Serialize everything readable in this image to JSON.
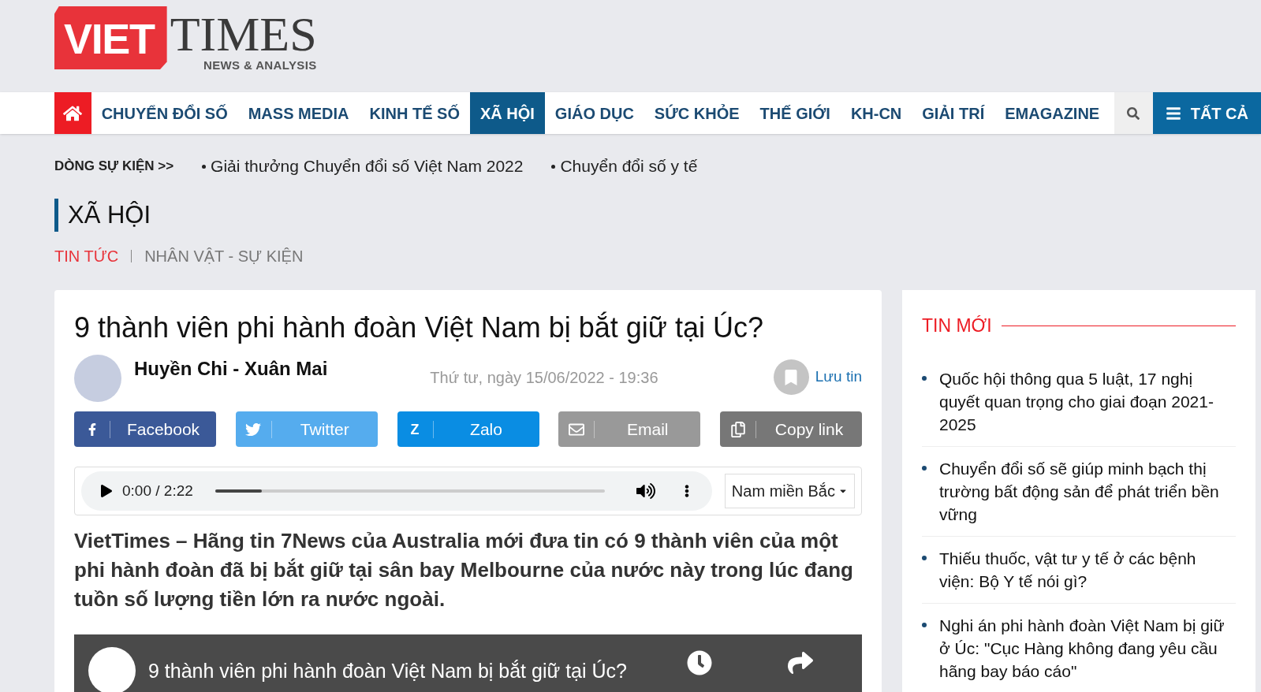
{
  "logo": {
    "mark": "VIET",
    "name": "TIMES",
    "tagline": "NEWS & ANALYSIS"
  },
  "nav": {
    "items": [
      {
        "label": "CHUYỂN ĐỔI SỐ",
        "selected": false
      },
      {
        "label": "MASS MEDIA",
        "selected": false
      },
      {
        "label": "KINH TẾ SỐ",
        "selected": false
      },
      {
        "label": "XÃ HỘI",
        "selected": true
      },
      {
        "label": "GIÁO DỤC",
        "selected": false
      },
      {
        "label": "SỨC KHỎE",
        "selected": false
      },
      {
        "label": "THẾ GIỚI",
        "selected": false
      },
      {
        "label": "KH-CN",
        "selected": false
      },
      {
        "label": "GIẢI TRÍ",
        "selected": false
      },
      {
        "label": "EMAGAZINE",
        "selected": false
      }
    ],
    "all_button": "TẤT CẢ"
  },
  "events": {
    "label": "DÒNG SỰ KIỆN >>",
    "items": [
      "Giải thưởng Chuyển đổi số Việt Nam 2022",
      "Chuyển đổi số y tế"
    ]
  },
  "section": {
    "title": "XÃ HỘI",
    "subnav": [
      {
        "label": "TIN TỨC",
        "selected": true
      },
      {
        "label": "NHÂN VẬT - SỰ KIỆN",
        "selected": false
      }
    ]
  },
  "article": {
    "title": "9 thành viên phi hành đoàn Việt Nam bị bắt giữ tại Úc?",
    "author": "Huyền Chi - Xuân Mai",
    "date": "Thứ tư, ngày 15/06/2022 - 19:36",
    "save": "Lưu tin",
    "share": [
      {
        "kind": "facebook",
        "label": "Facebook",
        "color": "#3b5998"
      },
      {
        "kind": "twitter",
        "label": "Twitter",
        "color": "#55acee"
      },
      {
        "kind": "zalo",
        "label": "Zalo",
        "icon": "Z",
        "color": "#0a8de3"
      },
      {
        "kind": "email",
        "label": "Email",
        "color": "#999999"
      },
      {
        "kind": "copy",
        "label": "Copy link",
        "color": "#777777"
      }
    ],
    "audio": {
      "time": "0:00 / 2:22",
      "level": 0.12,
      "voice": "Nam miền Bắc"
    },
    "lead": "VietTimes – Hãng tin 7News của Australia mới đưa tin có 9 thành viên của một phi hành đoàn đã bị bắt giữ tại sân bay Melbourne của nước này trong lúc đang tuồn số lượng tiền lớn ra nước ngoài.",
    "video": {
      "title": "9 thành viên phi hành đoàn Việt Nam bị bắt giữ tại Úc?"
    }
  },
  "sidebar": {
    "title": "TIN MỚI",
    "items": [
      "Quốc hội thông qua 5 luật, 17 nghị quyết quan trọng cho giai đoạn 2021-2025",
      "Chuyển đổi số sẽ giúp minh bạch thị trường bất động sản để phát triển bền vững",
      "Thiếu thuốc, vật tư y tế ở các bệnh viện: Bộ Y tế nói gì?",
      "Nghi án phi hành đoàn Việt Nam bị giữ ở Úc: \"Cục Hàng không đang yêu cầu hãng bay báo cáo\""
    ]
  }
}
